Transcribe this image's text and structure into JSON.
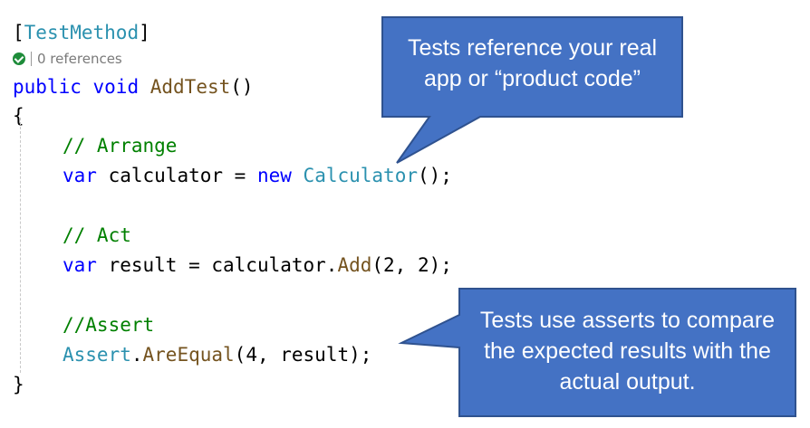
{
  "code": {
    "attr_open": "[",
    "attr_name": "TestMethod",
    "attr_close": "]",
    "references": "0 references",
    "kw_public": "public",
    "kw_void": "void",
    "method_name": "AddTest",
    "parens": "()",
    "brace_open": "{",
    "comment_arrange": "// Arrange",
    "kw_var1": "var",
    "calc_decl": " calculator = ",
    "kw_new": "new",
    "calc_type": "Calculator",
    "calc_end": "();",
    "comment_act": "// Act",
    "kw_var2": "var",
    "result_decl": " result = calculator.",
    "add_method": "Add",
    "add_args": "(2, 2);",
    "comment_assert": "//Assert",
    "assert_type": "Assert",
    "dot": ".",
    "are_equal": "AreEqual",
    "assert_args": "(4, result);",
    "brace_close": "}"
  },
  "callouts": {
    "top": {
      "line1": "Tests reference your real",
      "line2": "app or “product code”"
    },
    "bottom": {
      "line1": "Tests use asserts to compare",
      "line2": "the expected results with the",
      "line3": "actual output."
    }
  },
  "colors": {
    "callout_fill": "#4472c4",
    "callout_stroke": "#2f528f",
    "keyword": "#0000ff",
    "type": "#2b91af",
    "method": "#74531f",
    "comment": "#008000"
  }
}
